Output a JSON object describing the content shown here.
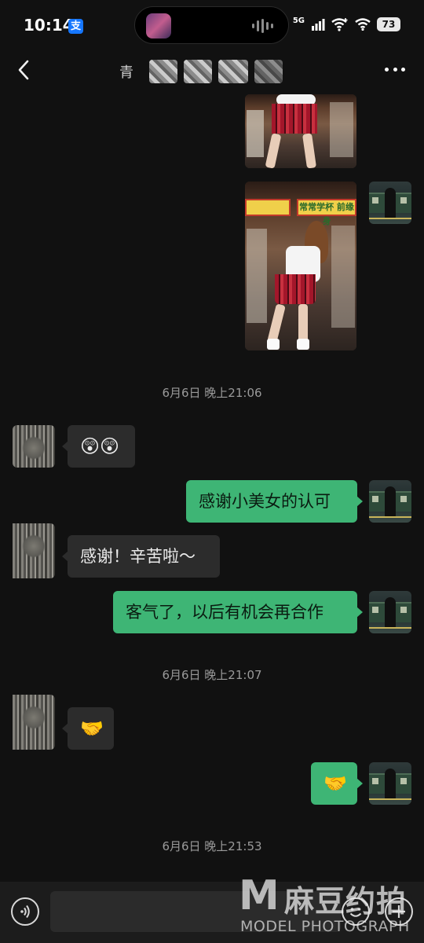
{
  "status_bar": {
    "time": "10:14",
    "alipay_icon_char": "支",
    "network": "5G",
    "battery": "73"
  },
  "nav": {
    "title_visible": "青",
    "title_obscured": true
  },
  "messages": [
    {
      "type": "image",
      "sender": "me",
      "name": "photo-1"
    },
    {
      "type": "image",
      "sender": "me",
      "name": "photo-2",
      "sign_text": "常常学杯 前缘身"
    },
    {
      "type": "timestamp",
      "text": "6月6日 晚上21:06"
    },
    {
      "type": "text",
      "sender": "them",
      "text": "😲😲"
    },
    {
      "type": "text",
      "sender": "me",
      "text": "感谢小美女的认可"
    },
    {
      "type": "text",
      "sender": "them",
      "text": "感谢！辛苦啦～"
    },
    {
      "type": "text",
      "sender": "me",
      "text": "客气了，以后有机会再合作"
    },
    {
      "type": "timestamp",
      "text": "6月6日 晚上21:07"
    },
    {
      "type": "text",
      "sender": "them",
      "text": "🤝"
    },
    {
      "type": "text",
      "sender": "me",
      "text": "🤝"
    },
    {
      "type": "timestamp",
      "text": "6月6日 晚上21:53"
    }
  ],
  "input": {
    "value": "",
    "placeholder": ""
  },
  "watermark": {
    "letter": "M",
    "cn": "麻豆约拍",
    "en": "MODEL PHOTOGRAPH"
  },
  "colors": {
    "background": "#111111",
    "bubble_me": "#3eb575",
    "bubble_them": "#2c2c2c",
    "timestamp": "#9a9a9a"
  }
}
